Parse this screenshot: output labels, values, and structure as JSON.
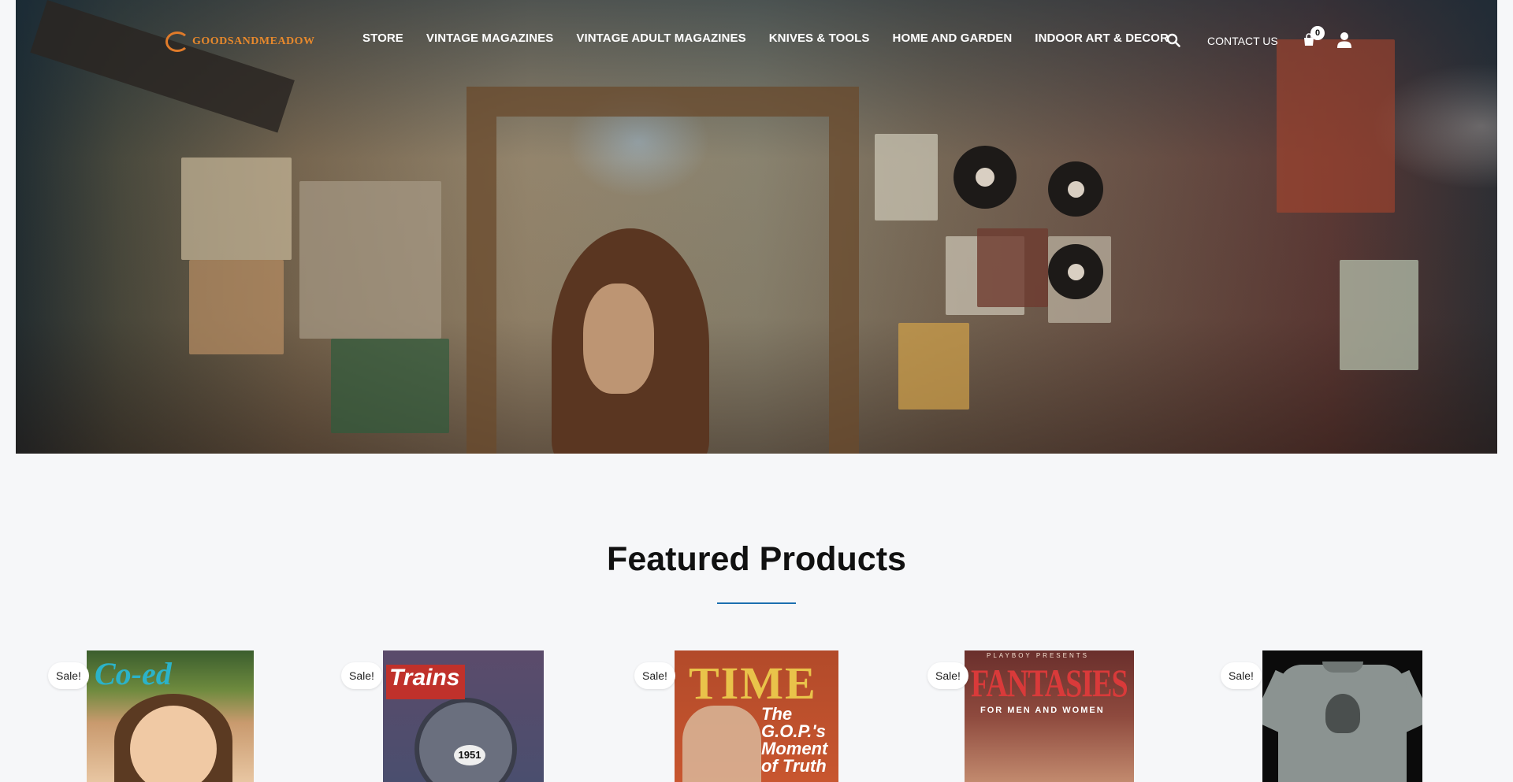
{
  "brand": {
    "name": "GOODSANDMEADOW",
    "accent_color": "#e8892c"
  },
  "nav": {
    "items": [
      {
        "label": "STORE"
      },
      {
        "label": "VINTAGE MAGAZINES"
      },
      {
        "label": "VINTAGE ADULT MAGAZINES"
      },
      {
        "label": "KNIVES & TOOLS"
      },
      {
        "label": "HOME AND GARDEN"
      },
      {
        "label": "INDOOR ART & DECOR"
      }
    ],
    "contact_label": "CONTACT US",
    "cart_count": "0",
    "icons": [
      "search-icon",
      "cart-icon",
      "user-icon"
    ]
  },
  "featured": {
    "title": "Featured Products",
    "divider_color": "#1c6fb0",
    "products": [
      {
        "badge": "Sale!",
        "cover_text": "Co-ed"
      },
      {
        "badge": "Sale!",
        "cover_text": "Trains",
        "cover_number": "1951"
      },
      {
        "badge": "Sale!",
        "cover_text": "TIME",
        "cover_subtitle": "The G.O.P.'s Moment of Truth"
      },
      {
        "badge": "Sale!",
        "cover_text": "FANTASIES",
        "cover_top": "PLAYBOY PRESENTS",
        "cover_subtitle": "FOR MEN AND WOMEN"
      },
      {
        "badge": "Sale!"
      }
    ]
  }
}
